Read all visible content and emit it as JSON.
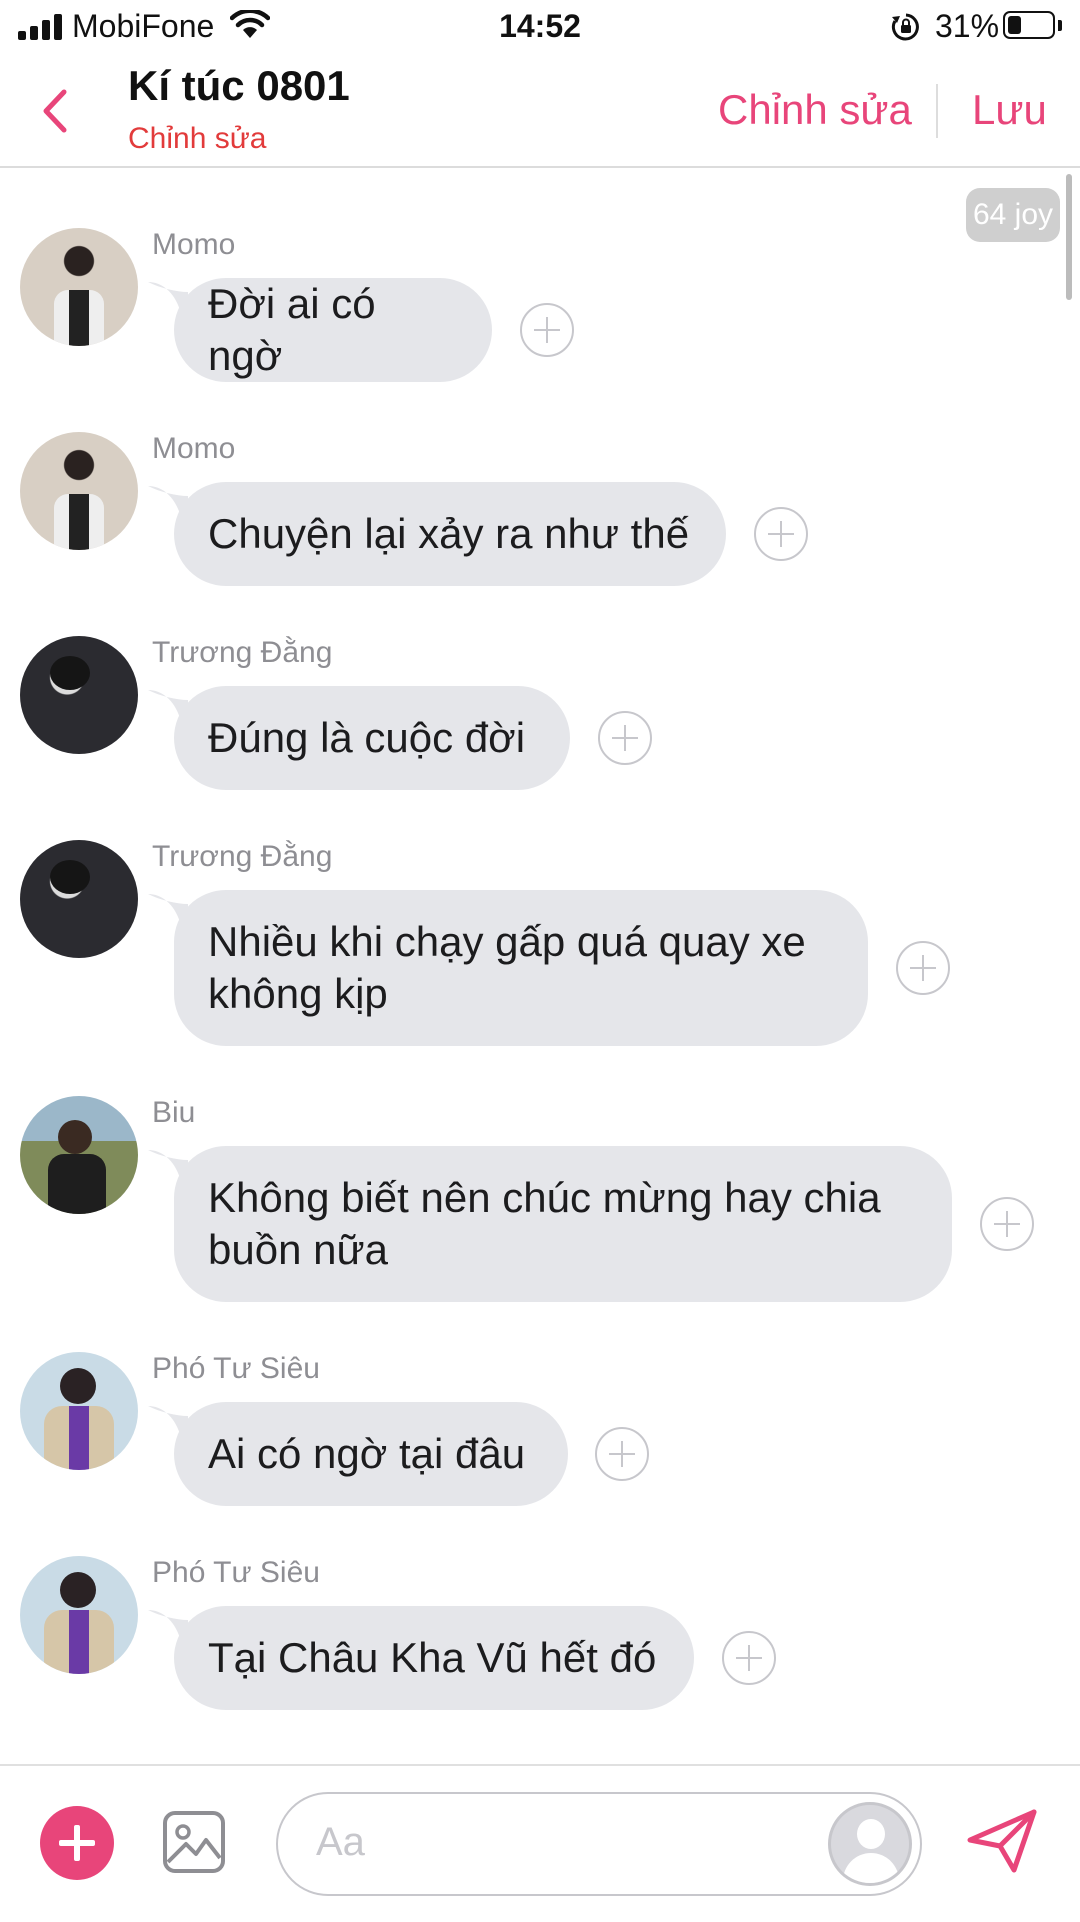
{
  "status_bar": {
    "carrier": "MobiFone",
    "time": "14:52",
    "battery": "31%",
    "battery_level": 0.31
  },
  "header": {
    "title": "Kí túc 0801",
    "subtitle": "Chỉnh sửa",
    "edit_label": "Chỉnh sửa",
    "save_label": "Lưu"
  },
  "chat": {
    "badge": "64 joy",
    "messages": [
      {
        "sender": "Momo",
        "text": "Đời ai có ngờ"
      },
      {
        "sender": "Momo",
        "text": "Chuyện lại xảy ra như thế"
      },
      {
        "sender": "Trương Đằng",
        "text": "Đúng là cuộc đời"
      },
      {
        "sender": "Trương Đằng",
        "text": "Nhiều khi chạy gấp quá quay xe không kịp"
      },
      {
        "sender": "Biu",
        "text": "Không biết nên chúc mừng hay chia buồn nữa"
      },
      {
        "sender": "Phó Tư Siêu",
        "text": "Ai có ngờ tại đâu"
      },
      {
        "sender": "Phó Tư Siêu",
        "text": "Tại Châu Kha Vũ hết đó"
      }
    ]
  },
  "composer": {
    "placeholder": "Aa"
  },
  "colors": {
    "accent": "#e8457a",
    "subtitle": "#e23b3b",
    "bubble": "#e5e6ea",
    "sender": "#8e8e93"
  }
}
